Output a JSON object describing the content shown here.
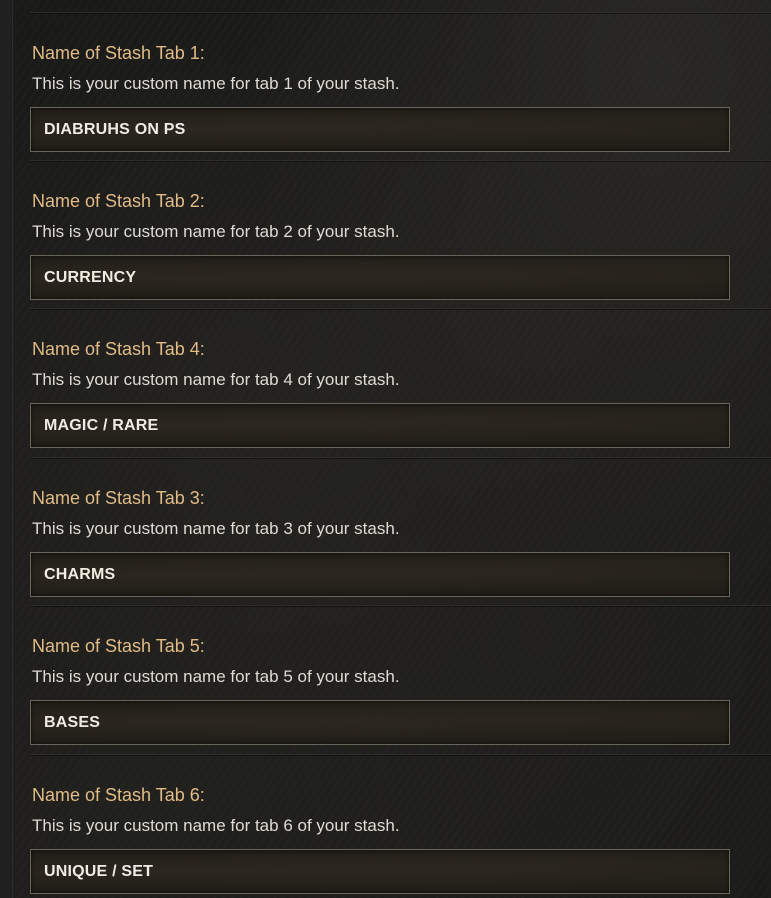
{
  "settings": [
    {
      "title": "Name of Stash Tab 1:",
      "description": "This is your custom name for tab 1 of your stash.",
      "value": "DIABRUHS ON PS"
    },
    {
      "title": "Name of Stash Tab 2:",
      "description": "This is your custom name for tab 2 of your stash.",
      "value": "CURRENCY"
    },
    {
      "title": "Name of Stash Tab 4:",
      "description": "This is your custom name for tab 4 of your stash.",
      "value": "MAGIC / RARE"
    },
    {
      "title": "Name of Stash Tab 3:",
      "description": "This is your custom name for tab 3 of your stash.",
      "value": "CHARMS"
    },
    {
      "title": "Name of Stash Tab 5:",
      "description": "This is your custom name for tab 5 of your stash.",
      "value": "BASES"
    },
    {
      "title": "Name of Stash Tab 6:",
      "description": "This is your custom name for tab 6 of your stash.",
      "value": "UNIQUE / SET"
    }
  ]
}
